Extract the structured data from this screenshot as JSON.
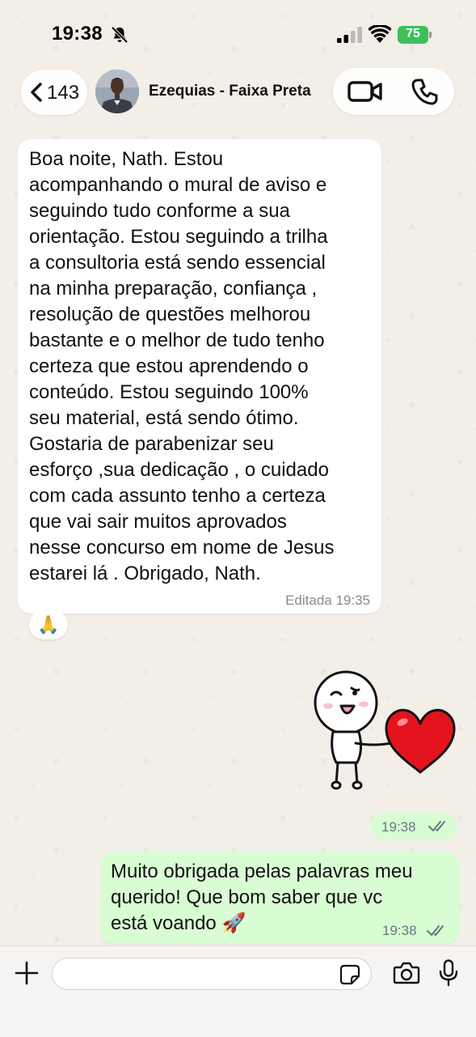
{
  "status_bar": {
    "time": "19:38",
    "battery": "75"
  },
  "header": {
    "back_count": "143",
    "contact_name": "Ezequias - Faixa Preta"
  },
  "messages": [
    {
      "direction": "incoming",
      "text": "Boa noite, Nath. Estou\nacompanhando o  mural de aviso e\nseguindo tudo conforme a sua\norientação. Estou seguindo a trilha\na consultoria está sendo essencial\nna minha preparação,   confiança ,\nresolução de  questões melhorou\nbastante e o melhor de tudo tenho\ncerteza que estou aprendendo  o\nconteúdo. Estou seguindo 100%\nseu material, está sendo ótimo.\nGostaria de parabenizar seu\nesforço ,sua  dedicação ,  o cuidado\ncom cada assunto tenho a certeza\nque vai sair muitos aprovados\nnesse concurso em nome de Jesus\nestarei lá . Obrigado, Nath.",
      "meta": "Editada  19:35",
      "reaction": "🙏"
    },
    {
      "direction": "outgoing",
      "type": "sticker",
      "time": "19:38"
    },
    {
      "direction": "outgoing",
      "text": "Muito obrigada pelas palavras meu\nquerido! Que bom saber que vc\nestá voando 🚀",
      "time": "19:38"
    }
  ],
  "composer": {
    "placeholder": ""
  },
  "colors": {
    "incoming_bubble": "#ffffff",
    "outgoing_bubble": "#d9fdd3",
    "chat_background": "#efeae2",
    "battery": "#3bc158",
    "read_ticks": "#667781"
  },
  "icons": [
    "bell-off-icon",
    "signal-icon",
    "wifi-icon",
    "battery-icon",
    "chevron-left-icon",
    "video-camera-icon",
    "phone-icon",
    "plus-icon",
    "sticker-icon",
    "camera-icon",
    "microphone-icon"
  ]
}
